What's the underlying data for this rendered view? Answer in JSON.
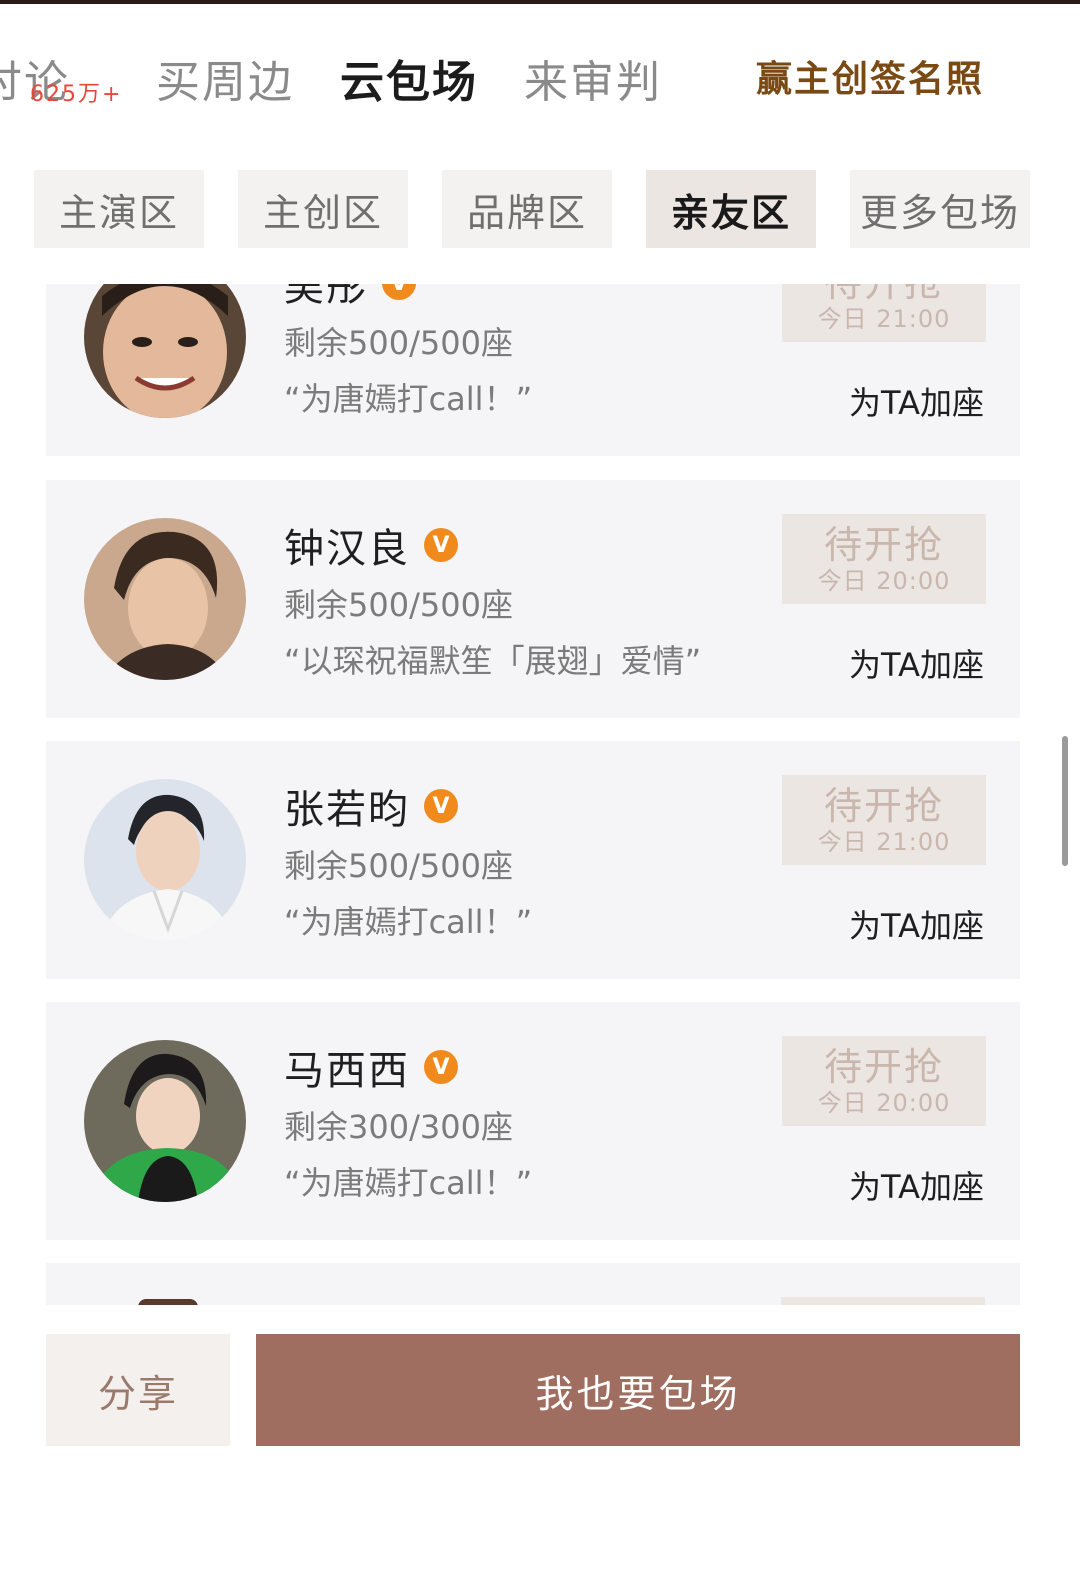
{
  "top_tabs": [
    {
      "label": "讨论",
      "badge": "625万+"
    },
    {
      "label": "买周边"
    },
    {
      "label": "云包场"
    },
    {
      "label": "来审判"
    }
  ],
  "active_tab": "云包场",
  "promo": "赢主创签名照",
  "categories": [
    "主演区",
    "主创区",
    "品牌区",
    "亲友区",
    "更多包场"
  ],
  "active_category": "亲友区",
  "cards": [
    {
      "name": "吴彤",
      "seats": "剩余500/500座",
      "slogan": "“为唐嫣打call！”",
      "status": "待开抢",
      "time": "今日 21:00",
      "action": "为TA加座"
    },
    {
      "name": "钟汉良",
      "seats": "剩余500/500座",
      "slogan": "“以琛祝福默笙「展翅」爱情”",
      "status": "待开抢",
      "time": "今日 20:00",
      "action": "为TA加座"
    },
    {
      "name": "张若昀",
      "seats": "剩余500/500座",
      "slogan": "“为唐嫣打call！”",
      "status": "待开抢",
      "time": "今日 21:00",
      "action": "为TA加座"
    },
    {
      "name": "马西西",
      "seats": "剩余300/300座",
      "slogan": "“为唐嫣打call！”",
      "status": "待开抢",
      "time": "今日 20:00",
      "action": "为TA加座"
    }
  ],
  "verified_glyph": "V",
  "bottom": {
    "share": "分享",
    "pack": "我也要包场"
  },
  "colors": {
    "accent": "#a06e60",
    "verified": "#f08a1c",
    "promo": "#7a4a14",
    "badge": "#e8463c"
  }
}
